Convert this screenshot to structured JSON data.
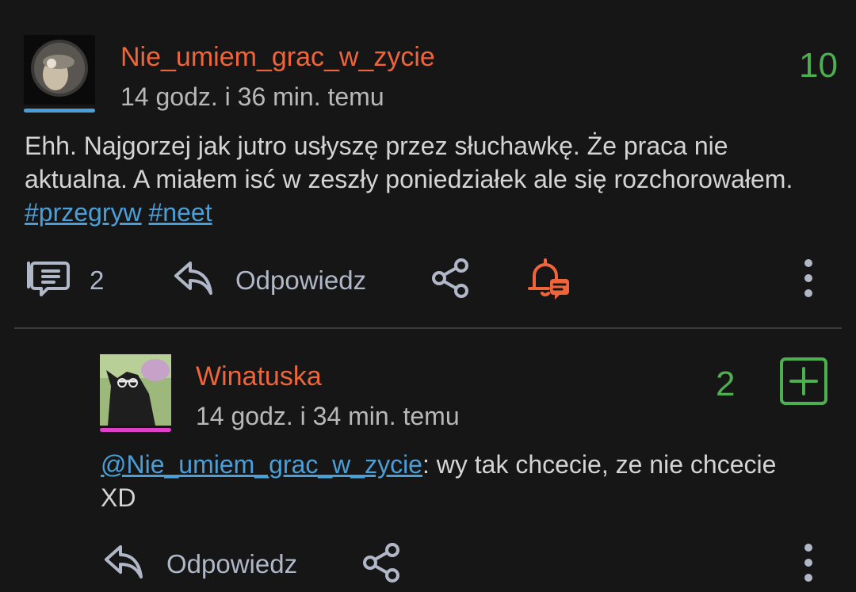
{
  "post": {
    "username": "Nie_umiem_grac_w_zycie",
    "timestamp": "14 godz. i 36 min. temu",
    "score": "10",
    "text_before": "Ehh. Najgorzej jak jutro usłyszę przez słuchawkę. Że praca nie aktualna. A miałem isć w zeszły poniedziałek ale się rozchorowałem. ",
    "tags": [
      "#przegryw",
      "#neet"
    ],
    "comment_count": "2",
    "reply_label": "Odpowiedz",
    "avatar_badge_color": "#4a9fd8"
  },
  "reply": {
    "username": "Winatuska",
    "timestamp": "14 godz. i 34 min. temu",
    "score": "2",
    "mention": "@Nie_umiem_grac_w_zycie",
    "text_after": ": wy tak chcecie, ze nie chcecie XD",
    "reply_label": "Odpowiedz",
    "avatar_badge_color": "#e040c8"
  },
  "colors": {
    "username": "#f0643a",
    "score": "#4caf50",
    "link": "#4a9fd8",
    "bell": "#f0643a"
  }
}
